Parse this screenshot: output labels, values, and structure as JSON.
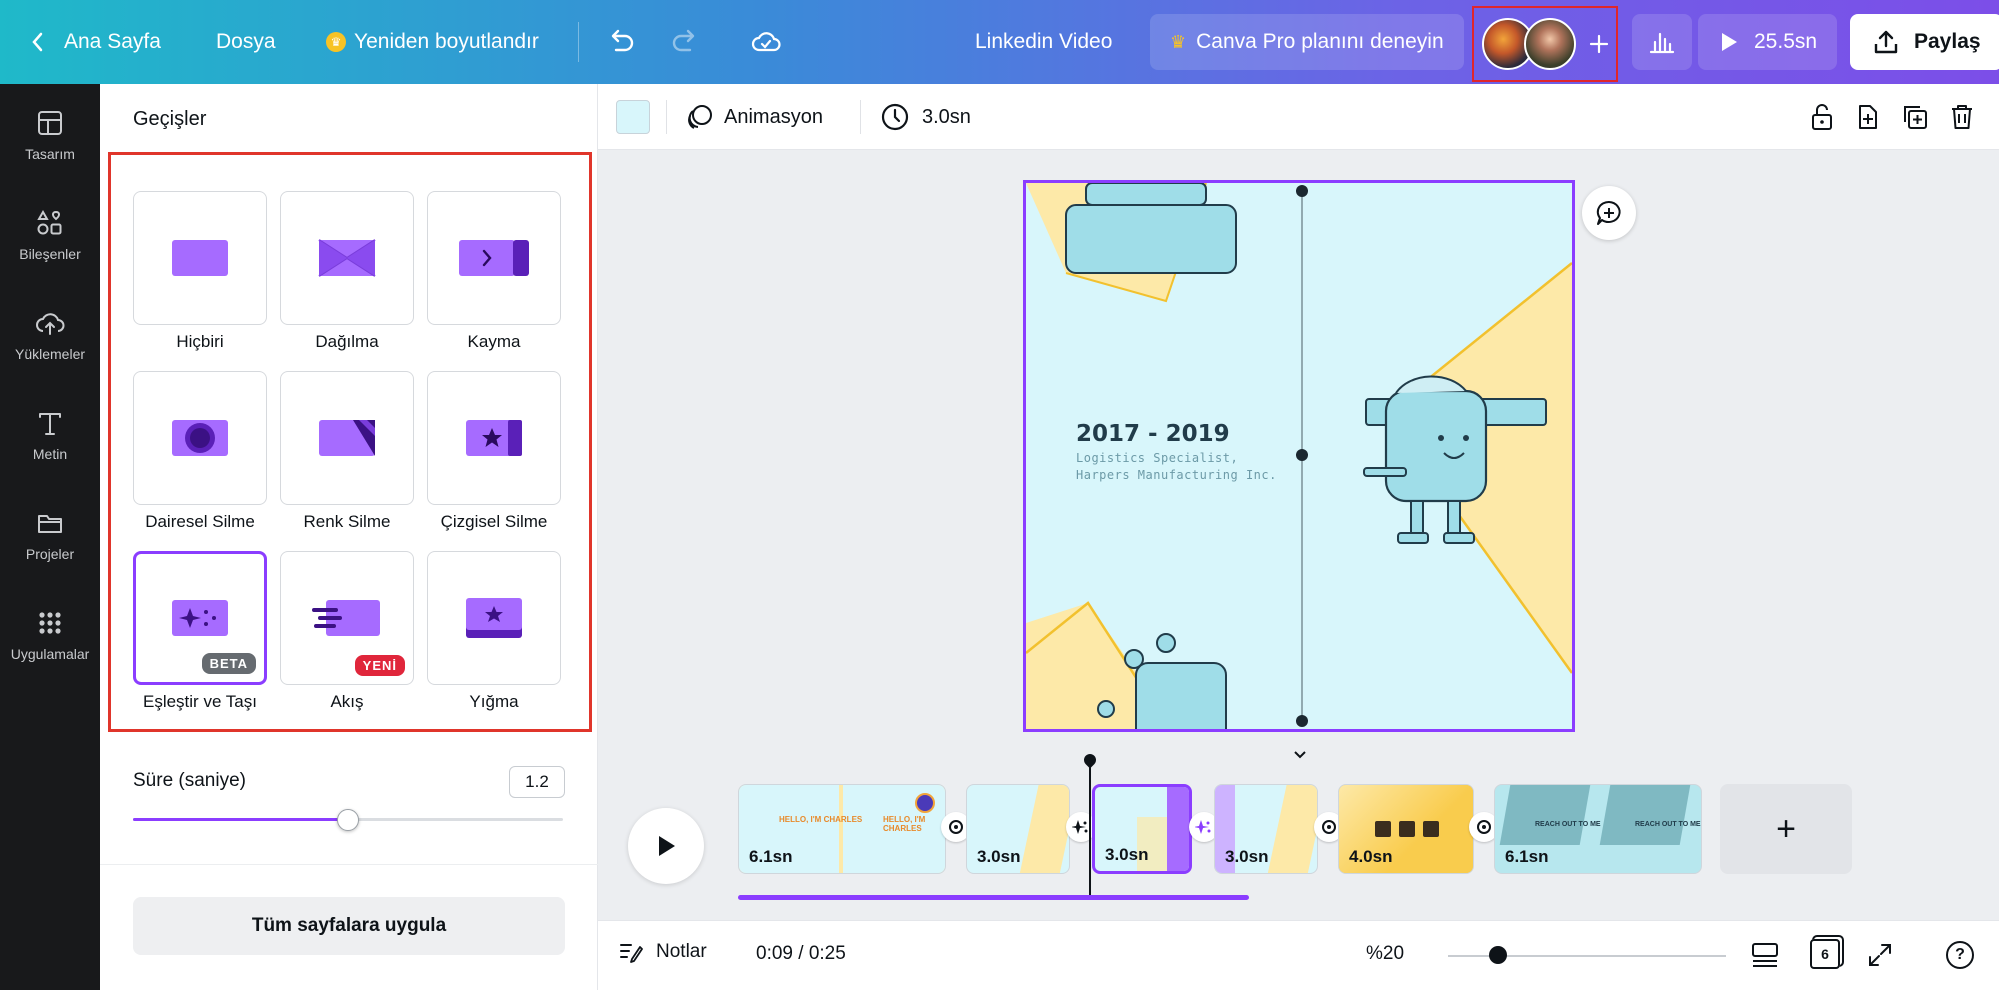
{
  "header": {
    "back_label": "Ana Sayfa",
    "file_label": "Dosya",
    "resize_label": "Yeniden boyutlandır",
    "doc_title": "Linkedin Video",
    "pro_label": "Canva Pro planını deneyin",
    "play_duration": "25.5sn",
    "share_label": "Paylaş"
  },
  "sidebar": {
    "items": [
      {
        "label": "Tasarım",
        "icon": "layout-icon"
      },
      {
        "label": "Bileşenler",
        "icon": "elements-icon"
      },
      {
        "label": "Yüklemeler",
        "icon": "upload-cloud-icon"
      },
      {
        "label": "Metin",
        "icon": "text-icon"
      },
      {
        "label": "Projeler",
        "icon": "folder-icon"
      },
      {
        "label": "Uygulamalar",
        "icon": "apps-grid-icon"
      }
    ]
  },
  "panel": {
    "title": "Geçişler",
    "transitions": [
      {
        "label": "Hiçbiri"
      },
      {
        "label": "Dağılma"
      },
      {
        "label": "Kayma"
      },
      {
        "label": "Dairesel Silme"
      },
      {
        "label": "Renk Silme"
      },
      {
        "label": "Çizgisel Silme"
      },
      {
        "label": "Eşleştir ve Taşı",
        "badge": "BETA",
        "selected": true
      },
      {
        "label": "Akış",
        "badge": "YENİ"
      },
      {
        "label": "Yığma"
      }
    ],
    "duration_label": "Süre (saniye)",
    "duration_value": "1.2",
    "duration_fraction": 0.5,
    "apply_label": "Tüm sayfalara uygula"
  },
  "toolbar": {
    "color_swatch": "#d8f6fb",
    "animation_label": "Animasyon",
    "duration_label": "3.0sn"
  },
  "page": {
    "heading": "2017 - 2019",
    "line1": "Logistics Specialist,",
    "line2": "Harpers Manufacturing Inc."
  },
  "timeline": {
    "clips": [
      {
        "label": "6.1sn",
        "thumb_text": "HELLO, I'M CHARLES"
      },
      {
        "label": "3.0sn"
      },
      {
        "label": "3.0sn",
        "selected": true
      },
      {
        "label": "3.0sn"
      },
      {
        "label": "4.0sn"
      },
      {
        "label": "6.1sn",
        "thumb_text": "REACH OUT TO ME"
      }
    ],
    "add_label": "+",
    "progress_fraction": 0.53
  },
  "footer": {
    "notes_label": "Notlar",
    "time": "0:09 / 0:25",
    "zoom": "%20",
    "zoom_fraction": 0.18,
    "page_count": "6",
    "help": "?"
  },
  "colors": {
    "accent": "#8b3dff",
    "highlight_border": "#e0352b",
    "canvas_bg": "#d8f6fb",
    "yellow": "#fde9a8"
  }
}
